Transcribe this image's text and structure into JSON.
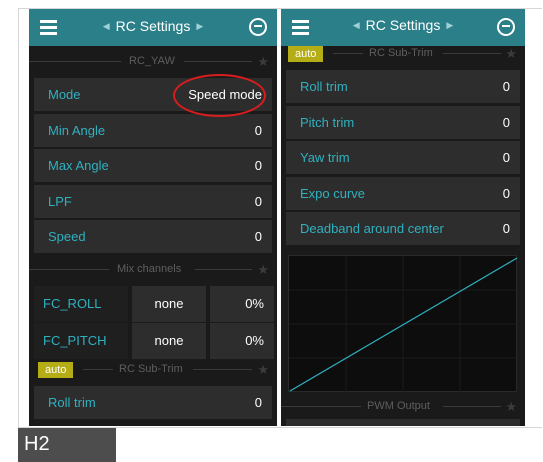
{
  "left_screen": {
    "header_title": "RC Settings",
    "section_yaw": "RC_YAW",
    "yaw_rows": [
      {
        "label": "Mode",
        "value": "Speed mode"
      },
      {
        "label": "Min Angle",
        "value": "0"
      },
      {
        "label": "Max Angle",
        "value": "0"
      },
      {
        "label": "LPF",
        "value": "0"
      },
      {
        "label": "Speed",
        "value": "0"
      }
    ],
    "section_mix": "Mix channels",
    "mix_rows": [
      {
        "name": "FC_ROLL",
        "source": "none",
        "percent": "0%"
      },
      {
        "name": "FC_PITCH",
        "source": "none",
        "percent": "0%"
      }
    ],
    "auto_badge": "auto",
    "section_subtrim": "RC Sub-Trim",
    "subtrim_rows": [
      {
        "label": "Roll trim",
        "value": "0"
      }
    ]
  },
  "right_screen": {
    "header_title": "RC Settings",
    "auto_badge": "auto",
    "section_subtrim": "RC Sub-Trim",
    "trim_rows": [
      {
        "label": "Roll trim",
        "value": "0"
      },
      {
        "label": "Pitch trim",
        "value": "0"
      },
      {
        "label": "Yaw trim",
        "value": "0"
      },
      {
        "label": "Expo curve",
        "value": "0"
      },
      {
        "label": "Deadband around center",
        "value": "0"
      }
    ],
    "section_pwm": "PWM Output"
  },
  "caption": "H2",
  "colors": {
    "appbar": "#2a7f89",
    "accent_text": "#2fb1c0",
    "auto_badge": "#b5ad16",
    "highlight_ring": "#d71d1d",
    "curve_line": "#2fb1c0"
  },
  "icons": [
    "menu-icon",
    "arrow-left-icon",
    "arrow-right-icon",
    "logout-icon",
    "star-icon"
  ]
}
